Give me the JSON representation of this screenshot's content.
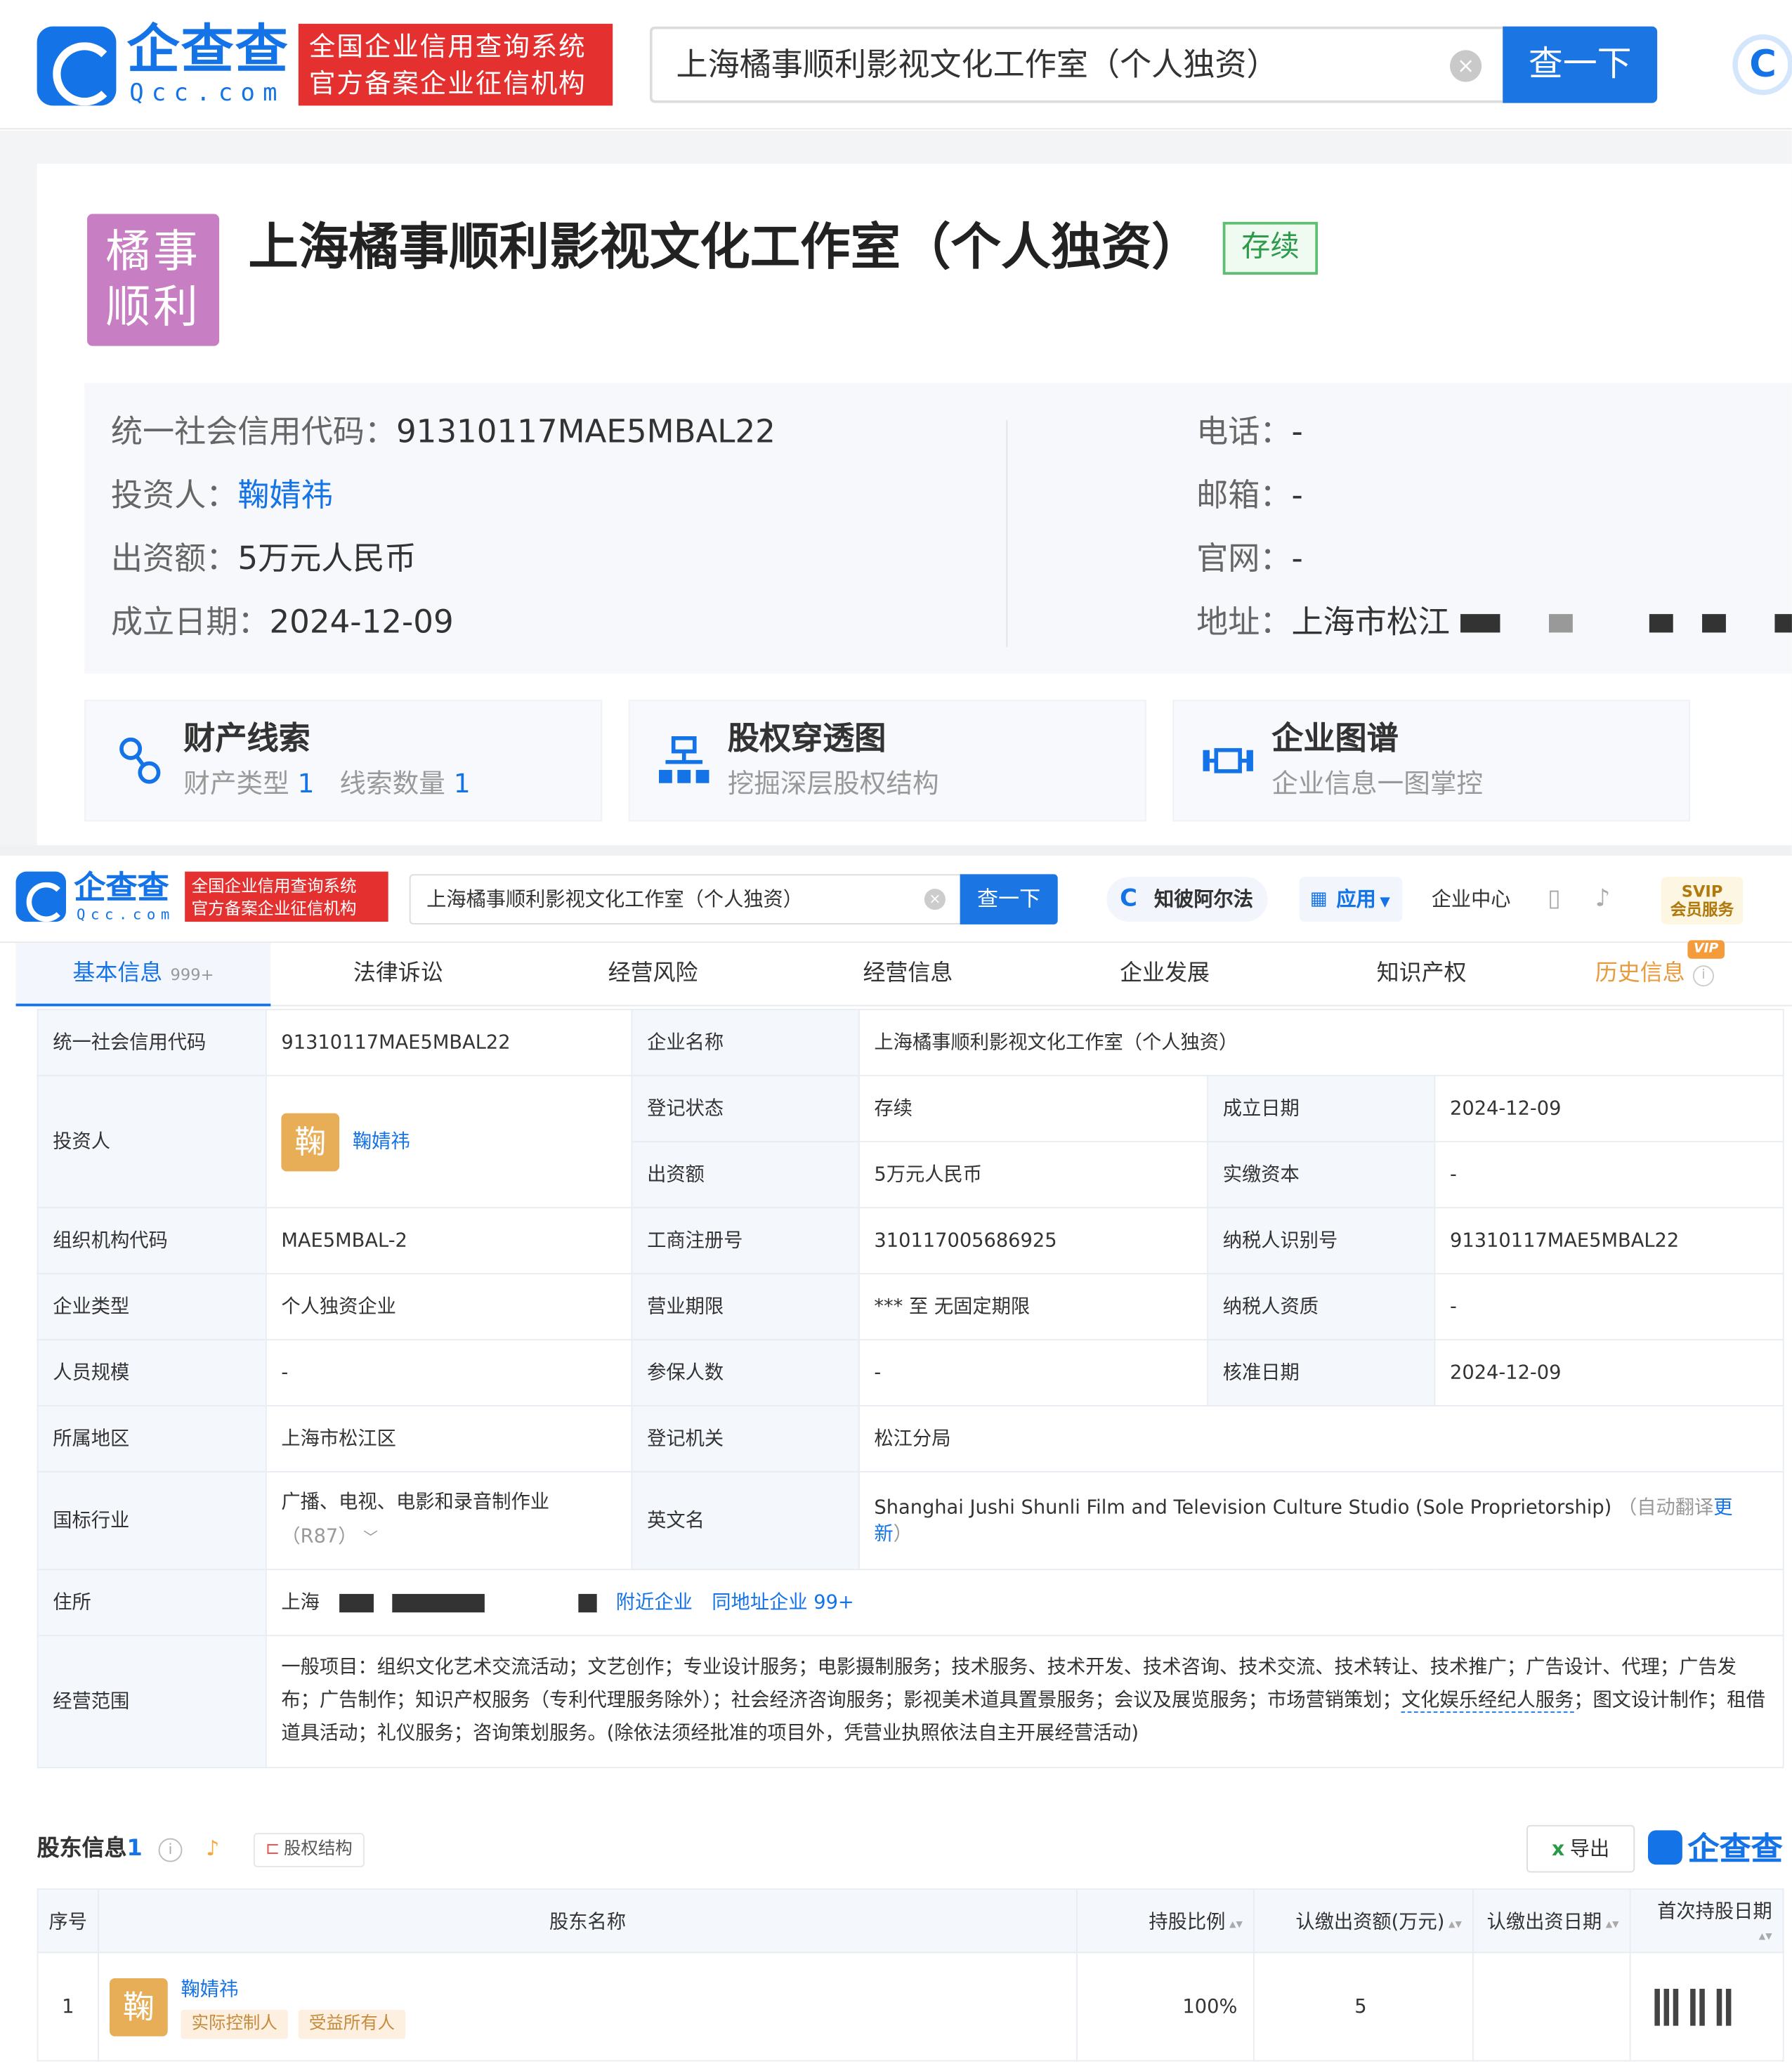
{
  "top_search": {
    "brand": "企查查",
    "brand_sub": "Qcc.com",
    "badge_line1": "全国企业信用查询系统",
    "badge_line2": "官方备案企业征信机构",
    "query": "上海橘事顺利影视文化工作室（个人独资）",
    "clear": "×",
    "button": "查一下",
    "right_logo": "C"
  },
  "company_card": {
    "avatar_line1": "橘事",
    "avatar_line2": "顺利",
    "name": "上海橘事顺利影视文化工作室（个人独资）",
    "status": "存续",
    "credit_code_label": "统一社会信用代码：",
    "credit_code": "91310117MAE5MBAL22",
    "investor_label": "投资人：",
    "investor": "鞠婧祎",
    "capital_label": "出资额：",
    "capital": "5万元人民币",
    "founded_label": "成立日期：",
    "founded": "2024-12-09",
    "phone_label": "电话：",
    "phone": "-",
    "email_label": "邮箱：",
    "email": "-",
    "website_label": "官网：",
    "website": "-",
    "address_label": "地址：",
    "address": "上海市松江",
    "features": [
      {
        "title": "财产线索",
        "sub_a": "财产类型",
        "num_a": "1",
        "sub_b": "线索数量",
        "num_b": "1",
        "icon": "link-chain-icon"
      },
      {
        "title": "股权穿透图",
        "sub": "挖掘深层股权结构",
        "icon": "org-chart-icon"
      },
      {
        "title": "企业图谱",
        "sub": "企业信息一图掌控",
        "icon": "graph-icon"
      }
    ]
  },
  "page_header": {
    "brand": "企查查",
    "brand_sub": "Qcc.com",
    "badge_line1": "全国企业信用查询系统",
    "badge_line2": "官方备案企业征信机构",
    "query": "上海橘事顺利影视文化工作室（个人独资）",
    "clear": "×",
    "button": "查一下",
    "zhibi": "知彼阿尔法",
    "apps": "应用",
    "enterprise_center": "企业中心",
    "svip_line1": "SVIP",
    "svip_line2": "会员服务"
  },
  "tabs": [
    {
      "label": "基本信息",
      "count": "999+"
    },
    {
      "label": "法律诉讼"
    },
    {
      "label": "经营风险"
    },
    {
      "label": "经营信息"
    },
    {
      "label": "企业发展"
    },
    {
      "label": "知识产权"
    },
    {
      "label": "历史信息",
      "badge": "VIP"
    }
  ],
  "basic_info": {
    "credit_code_label": "统一社会信用代码",
    "credit_code": "91310117MAE5MBAL22",
    "company_name_label": "企业名称",
    "company_name": "上海橘事顺利影视文化工作室（个人独资）",
    "investor_label": "投资人",
    "investor_avatar": "鞠",
    "investor": "鞠婧祎",
    "reg_status_label": "登记状态",
    "reg_status": "存续",
    "founded_label": "成立日期",
    "founded": "2024-12-09",
    "capital_label": "出资额",
    "capital": "5万元人民币",
    "paid_capital_label": "实缴资本",
    "paid_capital": "-",
    "org_code_label": "组织机构代码",
    "org_code": "MAE5MBAL-2",
    "biz_reg_no_label": "工商注册号",
    "biz_reg_no": "310117005686925",
    "taxpayer_id_label": "纳税人识别号",
    "taxpayer_id": "91310117MAE5MBAL22",
    "type_label": "企业类型",
    "type": "个人独资企业",
    "term_label": "营业期限",
    "term": "*** 至 无固定期限",
    "tax_qual_label": "纳税人资质",
    "tax_qual": "-",
    "staff_label": "人员规模",
    "staff": "-",
    "insured_label": "参保人数",
    "insured": "-",
    "approved_label": "核准日期",
    "approved": "2024-12-09",
    "region_label": "所属地区",
    "region": "上海市松江区",
    "authority_label": "登记机关",
    "authority": "松江分局",
    "industry_label": "国标行业",
    "industry": "广播、电视、电影和录音制作业",
    "industry_code": "（R87）",
    "english_label": "英文名",
    "english": "Shanghai Jushi Shunli Film and Television Culture Studio (Sole Proprietorship)",
    "auto_translate": "（自动翻译",
    "update": "更新",
    "close_paren": "）",
    "address_label": "住所",
    "address": "上海",
    "nearby": "附近企业",
    "same_address": "同地址企业 99+",
    "scope_label": "经营范围",
    "scope_part1": "一般项目：组织文化艺术交流活动；文艺创作；专业设计服务；电影摄制服务；技术服务、技术开发、技术咨询、技术交流、技术转让、技术推广；广告设计、代理；广告发布；广告制作；知识产权服务（专利代理服务除外）；社会经济咨询服务；影视美术道具置景服务；会议及展览服务；市场营销策划；",
    "scope_link": "文化娱乐经纪人服务",
    "scope_part2": "；图文设计制作；租借道具活动；礼仪服务；咨询策划服务。(除依法须经批准的项目外，凭营业执照依法自主开展经营活动)"
  },
  "shareholders": {
    "title": "股东信息",
    "count": "1",
    "structure": "股权结构",
    "export": "导出",
    "watermark": "企查查",
    "columns": [
      "序号",
      "股东名称",
      "持股比例",
      "认缴出资额(万元)",
      "认缴出资日期",
      "首次持股日期"
    ],
    "rows": [
      {
        "index": "1",
        "avatar": "鞠",
        "name": "鞠婧祎",
        "tag1": "实际控制人",
        "tag2": "受益所有人",
        "ratio": "100%",
        "amount": "5"
      }
    ]
  }
}
